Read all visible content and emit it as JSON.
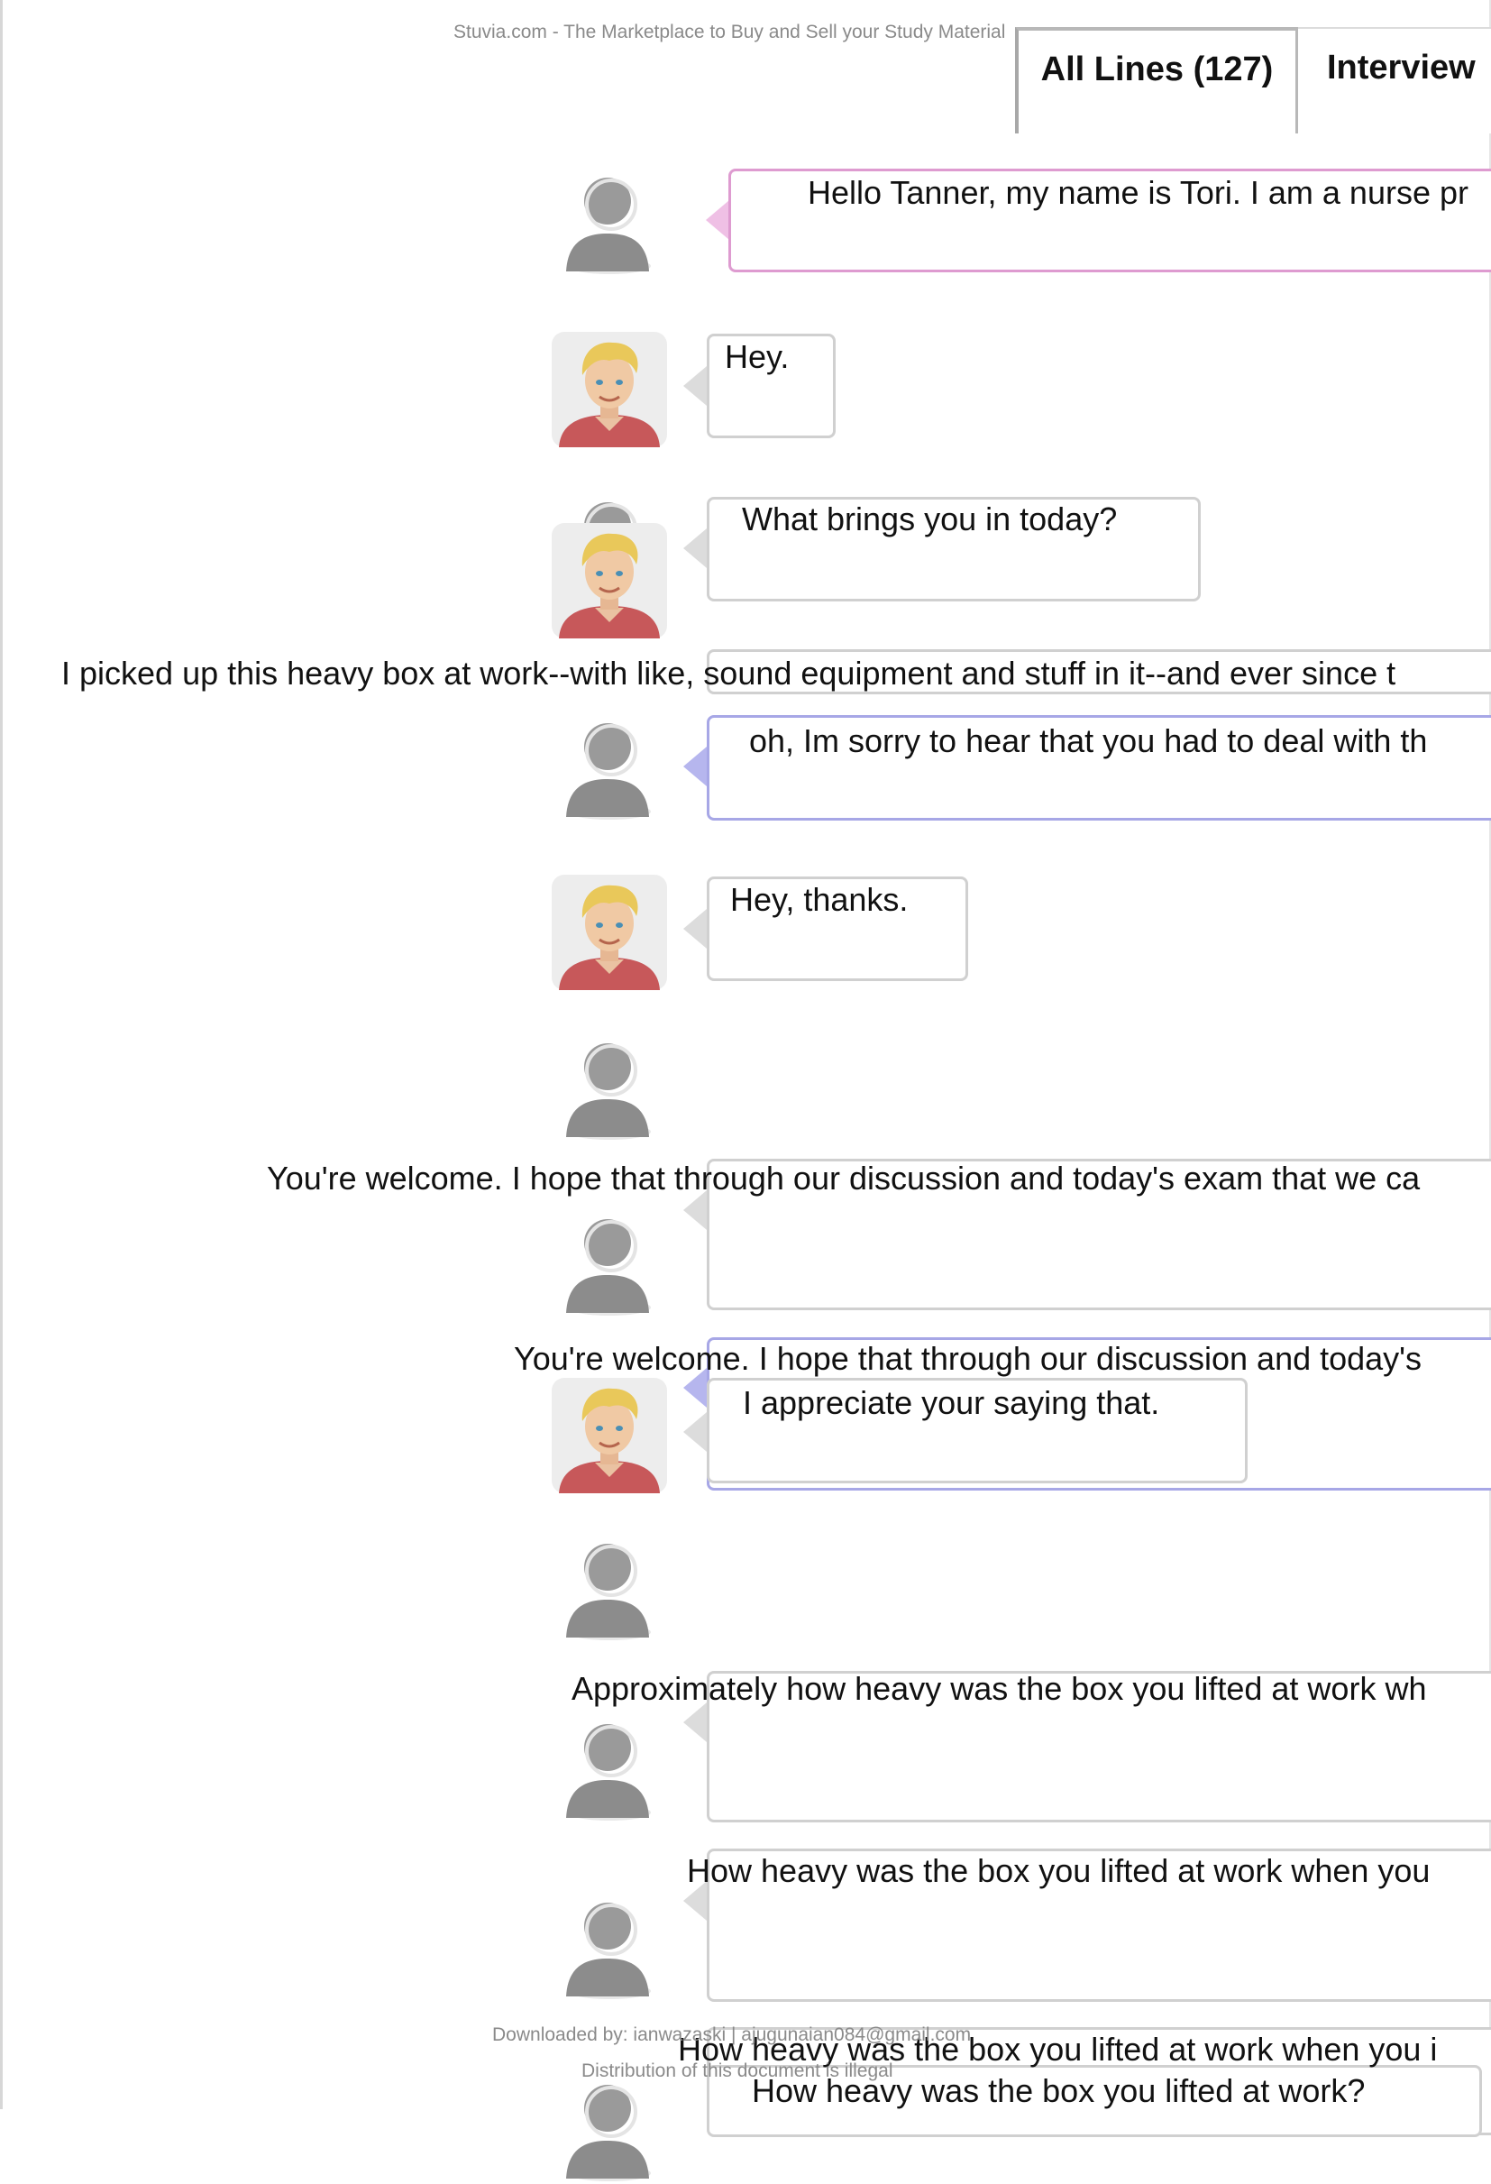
{
  "watermark": {
    "top": "Stuvia.com - The Marketplace to Buy and Sell your Study Material",
    "footer_downloaded": "Downloaded by: ianwazaski | ajugunaian084@gmail.com",
    "footer_notice": "Distribution of this document is illegal"
  },
  "tabs": {
    "all_lines": "All Lines (127)",
    "interview": "Interview"
  },
  "colors": {
    "nurse_bubble_border": "#de9bd0",
    "student_bubble_border": "#a7a7e6",
    "patient_bubble_border": "#d0d0d0",
    "tab_border": "#a8a8a8"
  },
  "conversation": {
    "line_1": "Hello Tanner, my name is Tori. I am a nurse pr",
    "line_2": "Hey.",
    "line_3": "What brings you in today?",
    "line_4": "I picked up this heavy box at work--with like, sound equipment and stuff in it--and ever since t",
    "line_5": "oh, Im sorry to hear that you had to deal with  th",
    "line_6": "Hey, thanks.",
    "line_7": "You're welcome. I hope that through our discussion and today's exam that we ca",
    "line_8": "You're welcome. I hope that through our discussion and today's",
    "line_9": "I appreciate your saying that.",
    "line_10": "Approximately how heavy was the box you lifted at work wh",
    "line_11": "How heavy was the box you lifted at work when you",
    "line_12": "How heavy was the box you lifted at work when you i",
    "line_13": "How heavy was the box you lifted at  work?"
  },
  "icons": {
    "generic": "generic-person-avatar-icon",
    "patient": "patient-avatar-icon"
  }
}
